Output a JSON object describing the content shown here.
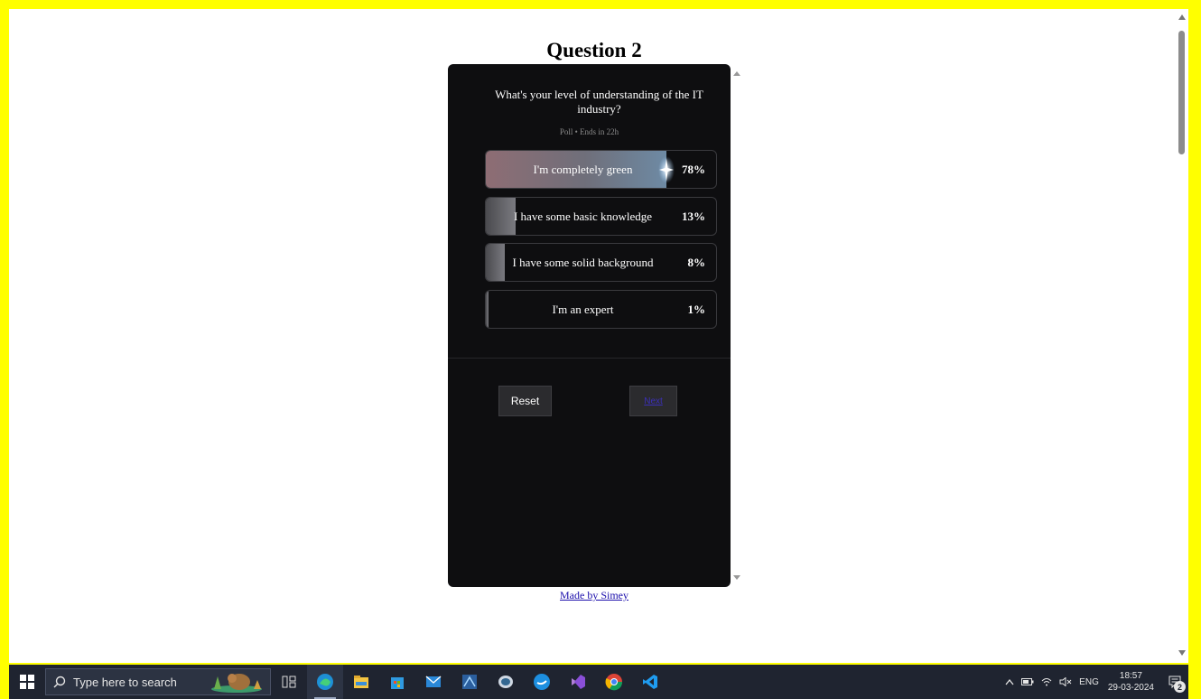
{
  "page": {
    "title": "Question 2",
    "footer_link": "Made by Simey"
  },
  "poll": {
    "question": "What's your level of understanding of the IT industry?",
    "meta": "Poll • Ends in 22h",
    "options": [
      {
        "label": "I'm completely green",
        "percent": "78%",
        "value": 0.78
      },
      {
        "label": "I have some basic knowledge",
        "percent": "13%",
        "value": 0.13
      },
      {
        "label": "I have some solid background",
        "percent": "8%",
        "value": 0.08
      },
      {
        "label": "I'm an expert",
        "percent": "1%",
        "value": 0.01
      }
    ]
  },
  "buttons": {
    "reset": "Reset",
    "next": "Next"
  },
  "taskbar": {
    "search_placeholder": "Type here to search",
    "apps": [
      "task-view-icon",
      "edge-icon",
      "file-explorer-icon",
      "microsoft-store-icon",
      "mail-icon",
      "azure-data-studio-icon",
      "pgadmin-icon",
      "docker-icon",
      "visual-studio-icon",
      "chrome-icon",
      "vscode-icon"
    ],
    "language": "ENG",
    "time": "18:57",
    "date": "29-03-2024",
    "notification_count": "2"
  },
  "colors": {
    "frame_border": "#ffff00",
    "poll_background": "#0e0e10",
    "taskbar": "#1f2430",
    "link": "#1a0dab"
  }
}
